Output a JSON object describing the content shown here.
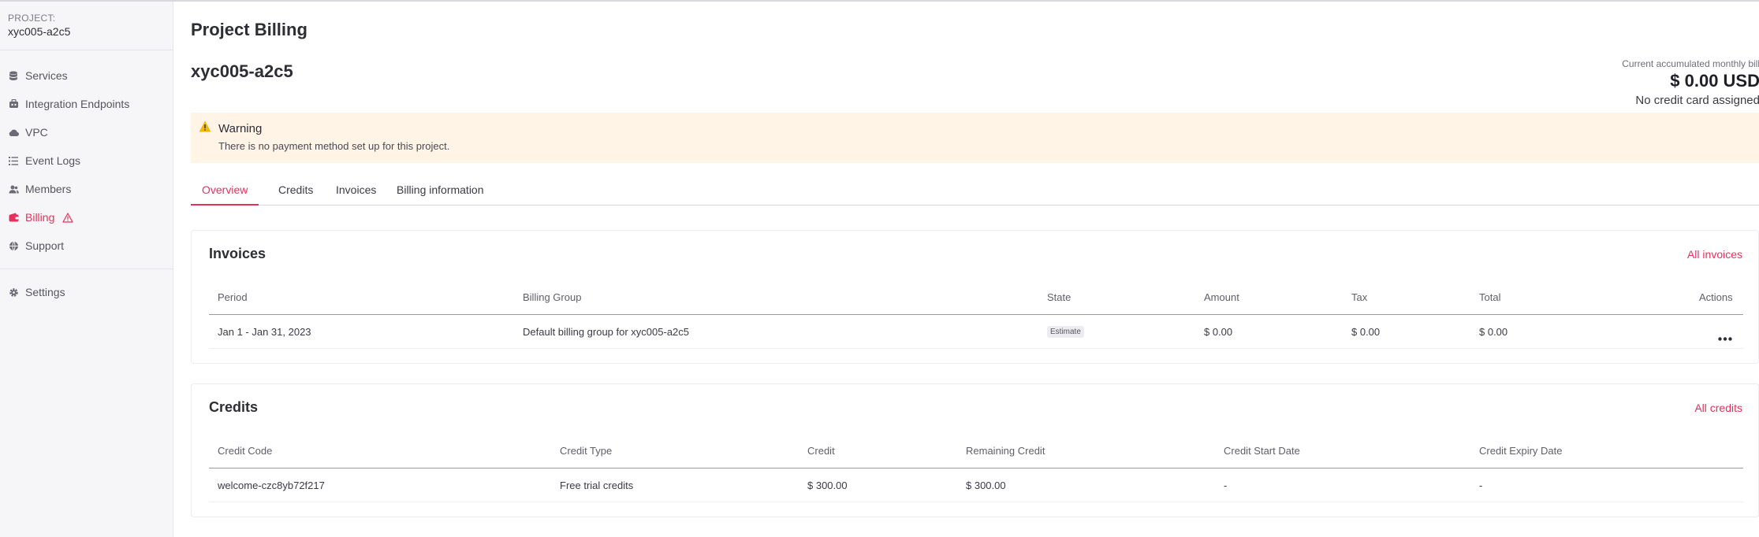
{
  "sidebar": {
    "project_label": "PROJECT:",
    "project_name": "xyc005-a2c5",
    "items": [
      {
        "label": "Services",
        "icon": "database-icon"
      },
      {
        "label": "Integration Endpoints",
        "icon": "integration-icon"
      },
      {
        "label": "VPC",
        "icon": "cloud-icon"
      },
      {
        "label": "Event Logs",
        "icon": "list-icon"
      },
      {
        "label": "Members",
        "icon": "members-icon"
      },
      {
        "label": "Billing",
        "icon": "wallet-icon",
        "active": true,
        "alert_icon": "warning-triangle-icon"
      },
      {
        "label": "Support",
        "icon": "globe-icon"
      }
    ],
    "settings": {
      "label": "Settings",
      "icon": "gear-icon"
    }
  },
  "header": {
    "title": "Project Billing",
    "project_heading": "xyc005-a2c5"
  },
  "bill_summary": {
    "label": "Current accumulated monthly bill",
    "amount": "$ 0.00 USD",
    "card_status": "No credit card assigned"
  },
  "warning": {
    "title": "Warning",
    "message": "There is no payment method set up for this project."
  },
  "tabs": [
    {
      "label": "Overview",
      "active": true
    },
    {
      "label": "Credits"
    },
    {
      "label": "Invoices"
    },
    {
      "label": "Billing information"
    }
  ],
  "invoices": {
    "title": "Invoices",
    "link": "All invoices",
    "columns": [
      "Period",
      "Billing Group",
      "State",
      "Amount",
      "Tax",
      "Total",
      "Actions"
    ],
    "rows": [
      {
        "period": "Jan 1 - Jan 31, 2023",
        "billing_group": "Default billing group for xyc005-a2c5",
        "state": "Estimate",
        "amount": "$ 0.00",
        "tax": "$ 0.00",
        "total": "$ 0.00"
      }
    ]
  },
  "credits": {
    "title": "Credits",
    "link": "All credits",
    "columns": [
      "Credit Code",
      "Credit Type",
      "Credit",
      "Remaining Credit",
      "Credit Start Date",
      "Credit Expiry Date"
    ],
    "rows": [
      {
        "code": "welcome-czc8yb72f217",
        "type": "Free trial credits",
        "credit": "$ 300.00",
        "remaining": "$ 300.00",
        "start": "-",
        "expiry": "-"
      }
    ]
  },
  "colors": {
    "accent": "#e5325c",
    "warning_bg": "#fff4e6",
    "warning_icon": "#f5b800",
    "sidebar_bg": "#f6f6f8"
  }
}
